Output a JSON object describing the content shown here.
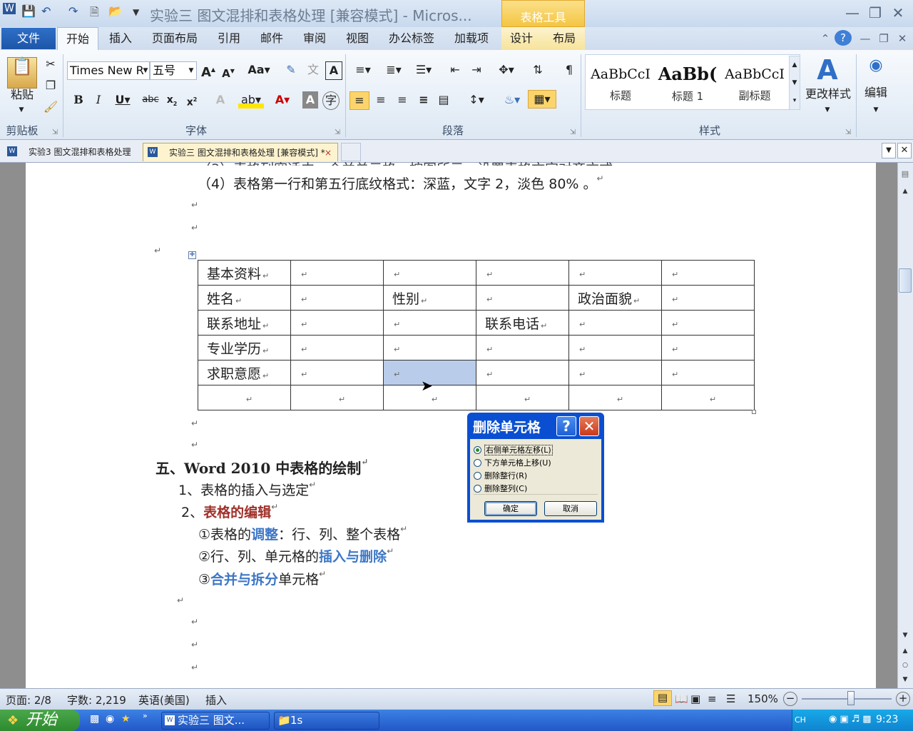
{
  "window": {
    "title": "实验三 图文混排和表格处理 [兼容模式] - Micros...",
    "context_tab_group": "表格工具"
  },
  "tabs": {
    "file": "文件",
    "home": "开始",
    "insert": "插入",
    "layout": "页面布局",
    "references": "引用",
    "mailings": "邮件",
    "review": "审阅",
    "view": "视图",
    "office_tags": "办公标签",
    "addins": "加载项",
    "design": "设计",
    "table_layout": "布局"
  },
  "ribbon": {
    "clipboard": {
      "paste": "粘贴",
      "label": "剪贴板"
    },
    "font": {
      "name": "Times New R",
      "size": "五号",
      "label": "字体"
    },
    "paragraph": {
      "label": "段落"
    },
    "styles": {
      "items": [
        {
          "sample": "AaBbCcI",
          "name": "标题"
        },
        {
          "sample": "AaBb(",
          "name": "标题 1"
        },
        {
          "sample": "AaBbCcI",
          "name": "副标题"
        }
      ],
      "change": "更改样式",
      "label": "样式"
    },
    "editing": {
      "label": "编辑"
    }
  },
  "doc_tabs": [
    "实验3 图文混排和表格处理",
    "实验三 图文混排和表格处理 [兼容模式] *"
  ],
  "document": {
    "line4": "（4）表格第一行和第五行底纹格式：深蓝，文字 2，淡色 80% 。",
    "table": [
      [
        "基本资料",
        "",
        "",
        "",
        "",
        ""
      ],
      [
        "姓名",
        "",
        "性别",
        "",
        "政治面貌",
        ""
      ],
      [
        "联系地址",
        "",
        "",
        "联系电话",
        "",
        ""
      ],
      [
        "专业学历",
        "",
        "",
        "",
        "",
        ""
      ],
      [
        "求职意愿",
        "",
        "",
        "",
        "",
        ""
      ],
      [
        "",
        "",
        "",
        "",
        "",
        ""
      ]
    ],
    "heading5": "五、Word 2010 中表格的绘制",
    "item1": "1、表格的插入与选定",
    "item2_num": "2、",
    "item2": "表格的编辑",
    "sub1_a": "①表格的",
    "sub1_b": "调整",
    "sub1_c": "：行、列、整个表格",
    "sub2_a": "②行、列、单元格的",
    "sub2_b": "插入与删除",
    "sub3_a": "③",
    "sub3_b": "合并与拆分",
    "sub3_c": "单元格"
  },
  "dialog": {
    "title": "删除单元格",
    "help": "?",
    "options": [
      "右侧单元格左移(L)",
      "下方单元格上移(U)",
      "删除整行(R)",
      "删除整列(C)"
    ],
    "selected_index": 0,
    "ok": "确定",
    "cancel": "取消"
  },
  "status": {
    "page": "页面: 2/8",
    "words": "字数: 2,219",
    "language": "英语(美国)",
    "mode": "插入",
    "zoom": "150%"
  },
  "taskbar": {
    "start": "开始",
    "items": [
      "实验三 图文...",
      "1s"
    ],
    "ime": "CH",
    "clock": "9:23"
  },
  "colors": {
    "accent_blue": "#2f6fc7",
    "heading_red": "#a0302a",
    "link_blue": "#3d77c6",
    "selection": "#b9cdea"
  }
}
